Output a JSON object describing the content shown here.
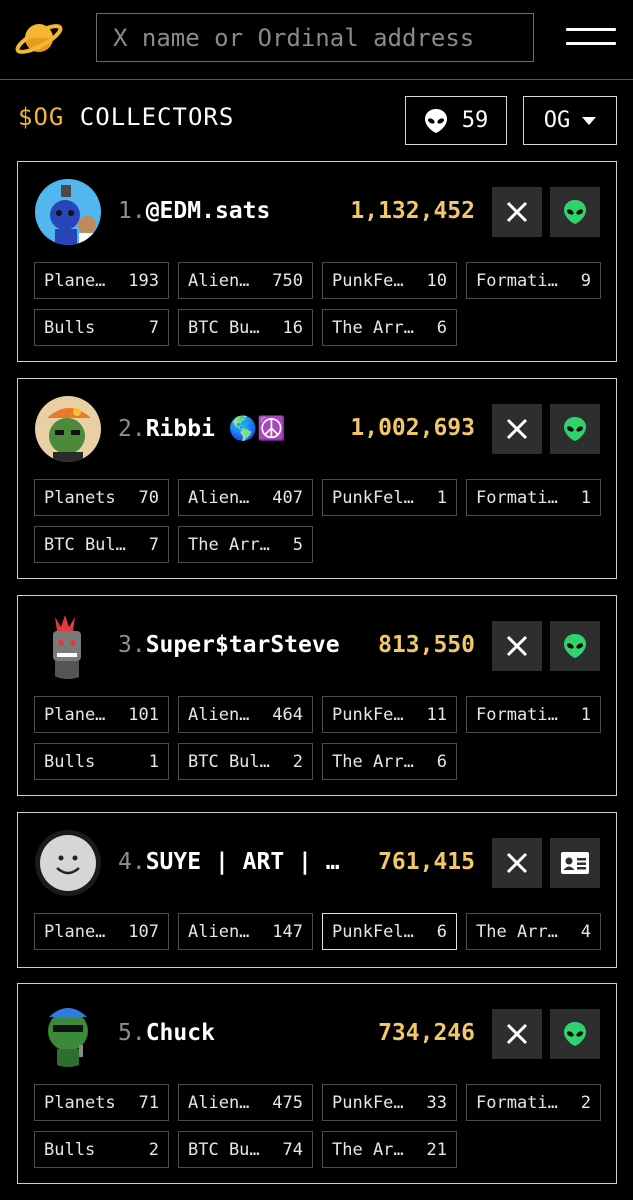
{
  "header": {
    "search_placeholder": "X name or Ordinal address"
  },
  "title": {
    "token": "$OG",
    "label": " COLLECTORS"
  },
  "controls": {
    "alien_count": "59",
    "filter_value": "OG"
  },
  "colors": {
    "accent": "#f2b632",
    "amount": "#f2c867",
    "alien_green": "#2fd36b",
    "button_bg": "#2e2e2e"
  },
  "collectors": [
    {
      "rank": "1.",
      "name": "@EDM.sats",
      "amount": "1,132,452",
      "profile_icon": "alien-icon",
      "tags": [
        {
          "name": "Plane…",
          "value": "193"
        },
        {
          "name": "Alien…",
          "value": "750"
        },
        {
          "name": "PunkFe…",
          "value": "10"
        },
        {
          "name": "Formati…",
          "value": "9"
        },
        {
          "name": "Bulls",
          "value": "7"
        },
        {
          "name": "BTC Bu…",
          "value": "16"
        },
        {
          "name": "The Arr…",
          "value": "6"
        }
      ]
    },
    {
      "rank": "2.",
      "name": "Ribbi 🌎☮️",
      "amount": "1,002,693",
      "profile_icon": "alien-icon",
      "tags": [
        {
          "name": "Planets",
          "value": "70"
        },
        {
          "name": "Alien…",
          "value": "407"
        },
        {
          "name": "PunkFel…",
          "value": "1"
        },
        {
          "name": "Formati…",
          "value": "1"
        },
        {
          "name": "BTC Bul…",
          "value": "7"
        },
        {
          "name": "The Arr…",
          "value": "5"
        }
      ]
    },
    {
      "rank": "3.",
      "name": "Super$tarSteve",
      "amount": "813,550",
      "profile_icon": "alien-icon",
      "tags": [
        {
          "name": "Plane…",
          "value": "101"
        },
        {
          "name": "Alien…",
          "value": "464"
        },
        {
          "name": "PunkFe…",
          "value": "11"
        },
        {
          "name": "Formati…",
          "value": "1"
        },
        {
          "name": "Bulls",
          "value": "1"
        },
        {
          "name": "BTC Bul…",
          "value": "2"
        },
        {
          "name": "The Arr…",
          "value": "6"
        }
      ]
    },
    {
      "rank": "4.",
      "name": "SUYE | ART | …",
      "amount": "761,415",
      "profile_icon": "id-card-icon",
      "tags": [
        {
          "name": "Plane…",
          "value": "107"
        },
        {
          "name": "Alien…",
          "value": "147"
        },
        {
          "name": "PunkFel…",
          "value": "6"
        },
        {
          "name": "The Arr…",
          "value": "4"
        }
      ]
    },
    {
      "rank": "5.",
      "name": "Chuck",
      "amount": "734,246",
      "profile_icon": "alien-icon",
      "tags": [
        {
          "name": "Planets",
          "value": "71"
        },
        {
          "name": "Alien…",
          "value": "475"
        },
        {
          "name": "PunkFe…",
          "value": "33"
        },
        {
          "name": "Formati…",
          "value": "2"
        },
        {
          "name": "Bulls",
          "value": "2"
        },
        {
          "name": "BTC Bu…",
          "value": "74"
        },
        {
          "name": "The Ar…",
          "value": "21"
        }
      ]
    }
  ]
}
